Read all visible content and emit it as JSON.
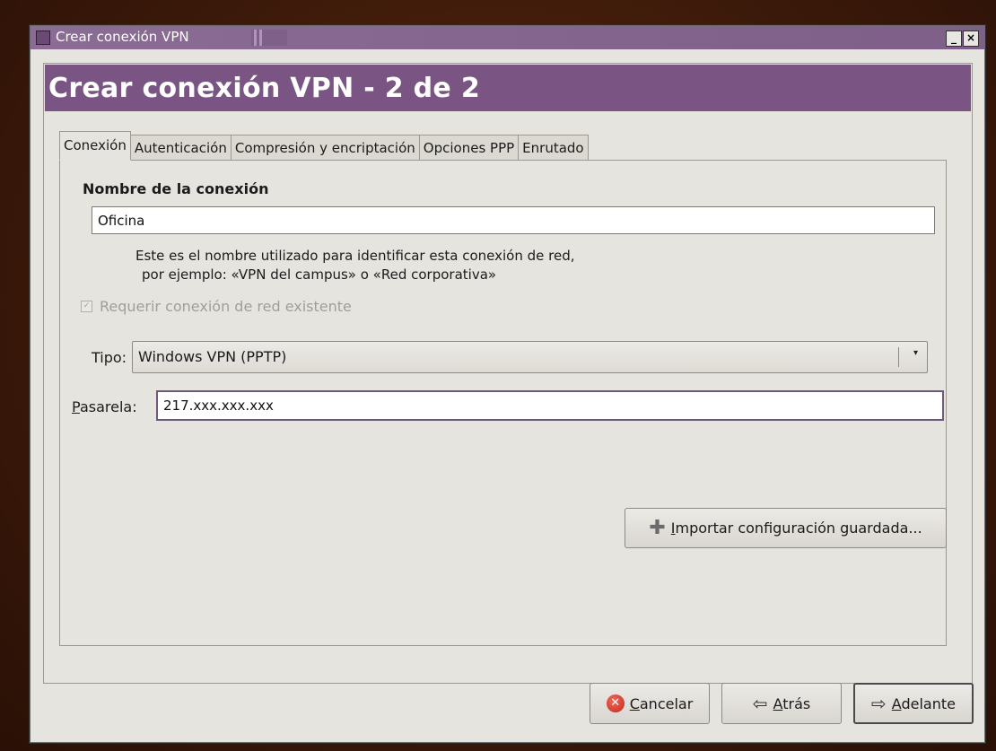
{
  "window": {
    "title": "Crear conexión VPN",
    "minimize_label": "_",
    "close_label": "×"
  },
  "header": {
    "title": "Crear conexión VPN - 2 de 2"
  },
  "tabs": [
    {
      "label": "Conexión",
      "active": true
    },
    {
      "label": "Autenticación",
      "active": false
    },
    {
      "label": "Compresión y encriptación",
      "active": false
    },
    {
      "label": "Opciones PPP",
      "active": false
    },
    {
      "label": "Enrutado",
      "active": false
    }
  ],
  "connection": {
    "section_title": "Nombre de la conexión",
    "name_value": "Oficina",
    "hint_line1": "Este es el nombre utilizado para identificar esta conexión de red,",
    "hint_line2": "por ejemplo: «VPN del campus» o «Red corporativa»",
    "require_network_label": "Requerir conexión de red existente",
    "require_network_checked": true,
    "require_network_enabled": false,
    "type_label": "Tipo:",
    "type_value": "Windows VPN (PPTP)",
    "gateway_label_mnemonic": "P",
    "gateway_label_rest": "asarela:",
    "gateway_value": "217.xxx.xxx.xxx"
  },
  "import_button": {
    "mnemonic": "I",
    "rest": "mportar configuración guardada..."
  },
  "footer": {
    "cancel": {
      "mnemonic": "C",
      "rest": "ancelar"
    },
    "back": {
      "mnemonic": "A",
      "rest": "trás"
    },
    "forward": {
      "mnemonic": "A",
      "rest": "delante"
    }
  },
  "colors": {
    "accent": "#7a5583",
    "titlebar": "#836690",
    "desktop": "#4a200e"
  }
}
